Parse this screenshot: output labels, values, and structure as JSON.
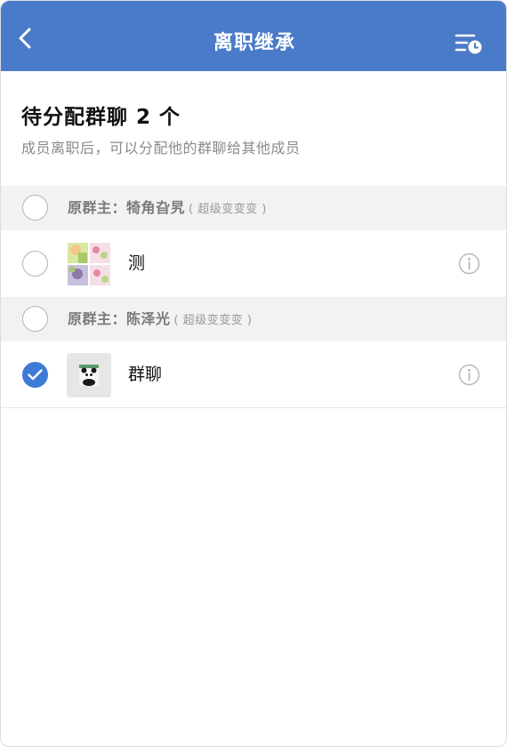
{
  "nav": {
    "title": "离职继承",
    "back_icon": "chevron-left-icon",
    "history_icon": "list-clock-icon",
    "color": "#4a7bc8"
  },
  "heading": {
    "title": "待分配群聊 2 个",
    "subtitle": "成员离职后，可以分配他的群聊给其他成员"
  },
  "owners": [
    {
      "prefix": "原群主：",
      "name": "犄角旮旯",
      "dept": "( 超级变变变 )",
      "selected": false,
      "groups": [
        {
          "name": "测",
          "selected": false,
          "avatar": "grid-collage-avatar"
        }
      ]
    },
    {
      "prefix": "原群主：",
      "name": "陈泽光",
      "dept": "( 超级变变变 )",
      "selected": false,
      "groups": [
        {
          "name": "群聊",
          "selected": true,
          "avatar": "panda-avatar"
        }
      ]
    }
  ],
  "accent_color": "#3e7bd4"
}
